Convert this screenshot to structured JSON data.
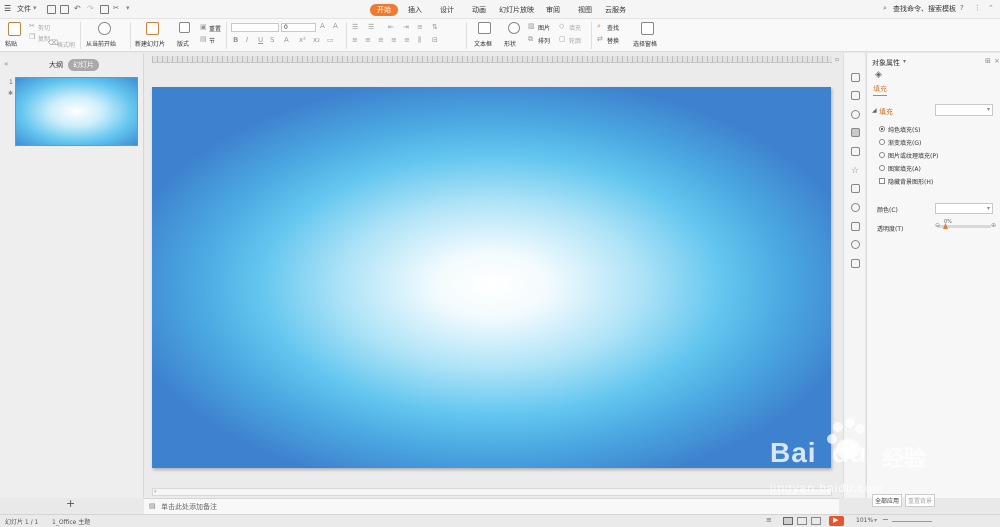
{
  "menubar": {
    "file_label": "文件",
    "tabs": [
      "开始",
      "插入",
      "设计",
      "动画",
      "幻灯片放映",
      "审阅",
      "视图",
      "云服务"
    ],
    "active_tab": "开始",
    "search_placeholder": "查找命令、搜索模板",
    "help_label": "?"
  },
  "ribbon": {
    "paste": "粘贴",
    "cut": "剪切",
    "copy": "复制",
    "format_painter": "格式刷",
    "from_current": "从当前开始",
    "new_slide": "新建幻灯片",
    "layout": "版式",
    "reset": "重置",
    "section": "节",
    "font_size": "0",
    "text_box": "文本框",
    "shapes": "形状",
    "arrange": "排列",
    "picture": "图片",
    "fill": "填充",
    "outline": "轮廓",
    "find": "查找",
    "replace": "替换",
    "select_pane": "选择窗格"
  },
  "leftpane": {
    "tab_outline": "大纲",
    "tab_slides": "幻灯片",
    "slide_number": "1",
    "add_slide": "+"
  },
  "notes": {
    "placeholder": "单击此处添加备注"
  },
  "properties": {
    "title": "对象属性",
    "subtab": "填充",
    "section_fill": "填充",
    "options": [
      "纯色填充(S)",
      "渐变填充(G)",
      "图片或纹理填充(P)",
      "图案填充(A)"
    ],
    "selected_option": "纯色填充(S)",
    "hide_bg": "隐藏背景图形(H)",
    "color_label": "颜色(C)",
    "transparency_label": "透明度(T)",
    "transparency_value": "0%",
    "apply_all": "全部应用",
    "reset_bg": "重置背景"
  },
  "statusbar": {
    "slide_info": "幻灯片 1 / 1",
    "theme": "1_Office 主题",
    "zoom": "101%"
  },
  "watermark": {
    "brand": "Bai",
    "brand2": "经验",
    "url": "jingyan.baidu.com"
  },
  "colors": {
    "accent": "#f07a2f",
    "slide_edge": "#3e82cf",
    "slide_center": "#ffffff"
  }
}
